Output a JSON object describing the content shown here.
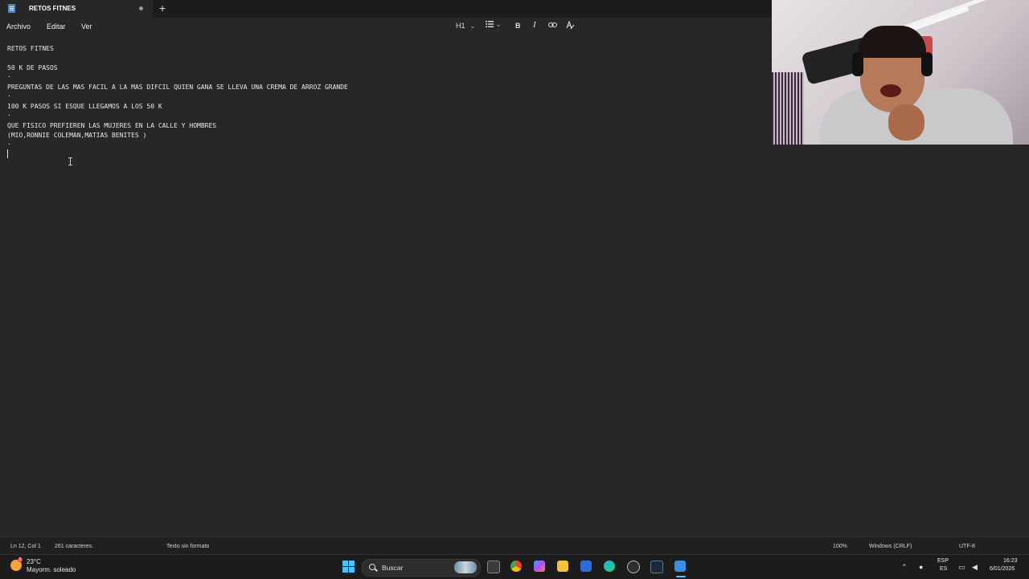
{
  "window": {
    "tab_title": "RETOS FITNES",
    "new_tab_symbol": "+"
  },
  "menu": {
    "archivo": "Archivo",
    "editar": "Editar",
    "ver": "Ver"
  },
  "toolbar": {
    "heading": "H1",
    "heading_chevron": "⌄",
    "list_chevron": "⌄",
    "bold": "B",
    "italic": "I"
  },
  "document": {
    "lines": [
      "RETOS FITNES",
      "",
      "50 K DE PASOS",
      ".",
      "PREGUNTAS DE LAS MAS FACIL A LA MAS DIFCIL QUIEN GANA SE LLEVA UNA CREMA DE ARROZ GRANDE",
      ".",
      "100 K PASOS SI ESQUE LLEGAMOS A LOS 50 K",
      ".",
      "QUE FISICO PREFIEREN LAS MUJERES EN LA CALLE Y HOMBRES",
      "(MIO,RONNIE COLEMAN,MATIAS BENITES )",
      "."
    ]
  },
  "status": {
    "position": "Ln 12, Col 1",
    "chars": "261 caracteres.",
    "format": "Texto sin formato",
    "zoom": "100%",
    "line_ending": "Windows (CRLF)",
    "encoding": "UTF-8"
  },
  "taskbar": {
    "weather_temp": "23°C",
    "weather_desc": "Mayorm. soleado",
    "weather_badge": "2",
    "search_label": "Buscar",
    "lang_top": "ESP",
    "lang_bottom": "ES",
    "time": "16:23",
    "date": "6/01/2026"
  },
  "colors": {
    "accent": "#4cc2ff",
    "background": "#272727"
  }
}
